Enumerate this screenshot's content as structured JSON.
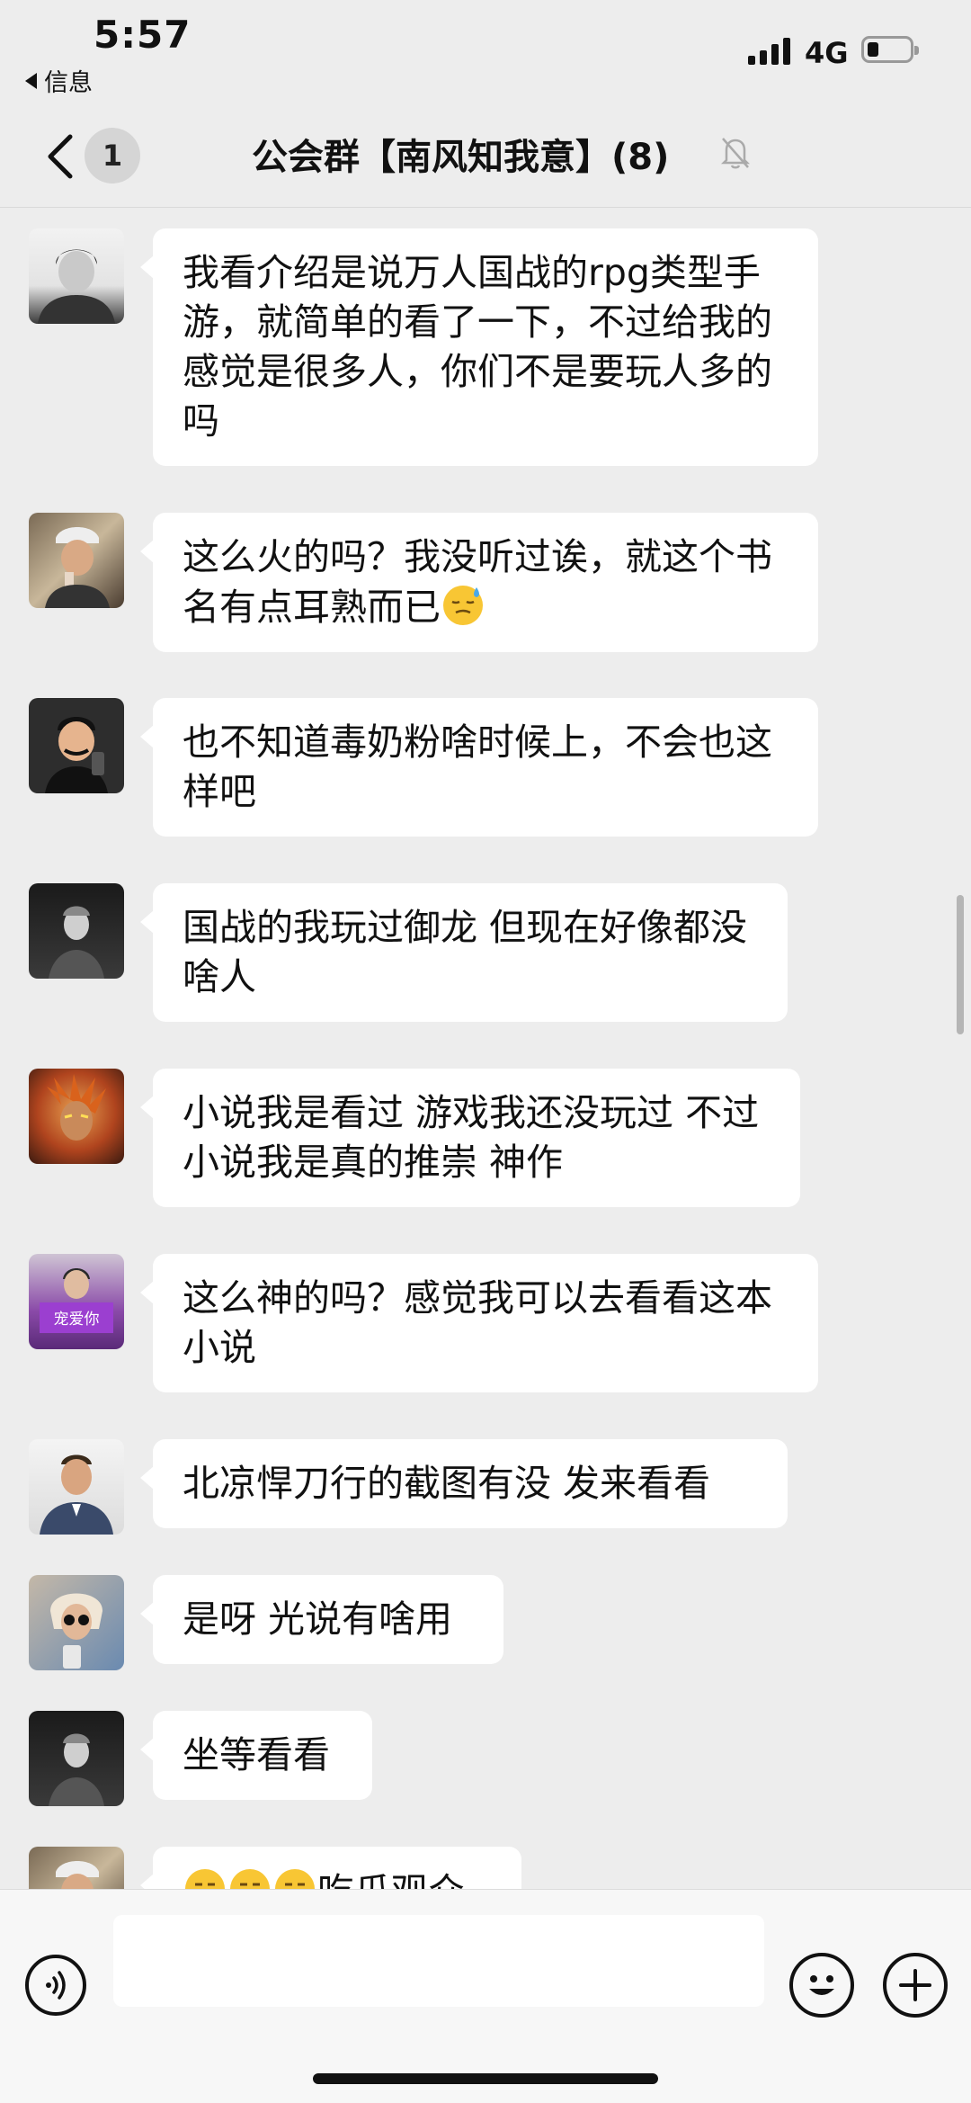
{
  "status_bar": {
    "time": "5:57",
    "back_app": "信息",
    "network": "4G"
  },
  "nav": {
    "badge_count": "1",
    "title": "公会群【南风知我意】(8)"
  },
  "messages": [
    {
      "text": "我看介绍是说万人国战的rpg类型手游，就简单的看了一下，不过给我的感觉是很多人，你们不是要玩人多的吗"
    },
    {
      "text": "这么火的吗？我没听过诶，就这个书名有点耳熟而已"
    },
    {
      "text": "也不知道毒奶粉啥时候上，不会也这样吧"
    },
    {
      "text": "国战的我玩过御龙 但现在好像都没啥人"
    },
    {
      "text": "小说我是看过 游戏我还没玩过 不过小说我是真的推崇  神作"
    },
    {
      "text": "这么神的吗？感觉我可以去看看这本小说"
    },
    {
      "text": "北凉悍刀行的截图有没 发来看看"
    },
    {
      "text": "是呀 光说有啥用"
    },
    {
      "text": "坐等看看"
    },
    {
      "text": "吃瓜观众"
    }
  ],
  "colors": {
    "background": "#ededed",
    "bubble": "#ffffff",
    "input_bar": "#f7f7f7"
  },
  "icons": {
    "back": "chevron-left-icon",
    "mute": "bell-off-icon",
    "voice": "voice-icon",
    "emoji": "smiley-icon",
    "plus": "plus-icon",
    "sweat_emoji": "sweat-smile-emoji",
    "smirk_emoji": "smirk-emoji"
  }
}
